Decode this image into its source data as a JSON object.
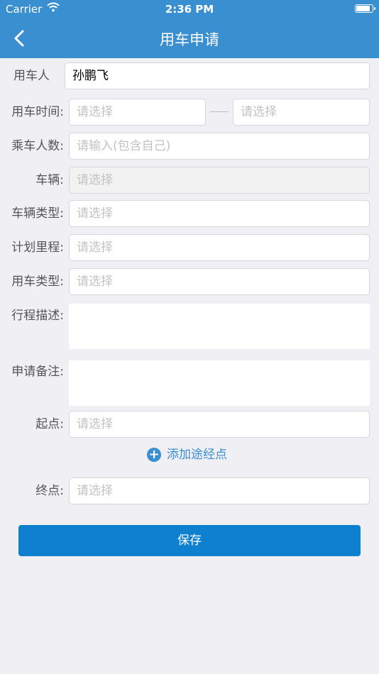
{
  "status_bar": {
    "carrier": "Carrier",
    "time": "2:36 PM",
    "battery_level": 0.9
  },
  "nav": {
    "title": "用车申请",
    "back_icon": "chevron-left-icon"
  },
  "form": {
    "user": {
      "label": "用车人",
      "value": "孙鹏飞"
    },
    "time": {
      "label": "用车时间:",
      "start_placeholder": "请选择",
      "end_placeholder": "请选择"
    },
    "passengers": {
      "label": "乘车人数:",
      "placeholder": "请输入(包含自己)"
    },
    "vehicle": {
      "label": "车辆:",
      "placeholder": "请选择"
    },
    "vehicle_type": {
      "label": "车辆类型:",
      "placeholder": "请选择"
    },
    "planned_mileage": {
      "label": "计划里程:",
      "placeholder": "请选择"
    },
    "usage_type": {
      "label": "用车类型:",
      "placeholder": "请选择"
    },
    "trip_description": {
      "label": "行程描述:"
    },
    "remarks": {
      "label": "申请备注:"
    },
    "start_point": {
      "label": "起点:",
      "placeholder": "请选择"
    },
    "add_waypoint": "添加途经点",
    "end_point": {
      "label": "终点:",
      "placeholder": "请选择"
    }
  },
  "save_label": "保存",
  "colors": {
    "primary": "#3a8fd0",
    "button": "#0f7fcf",
    "background": "#efeff4"
  }
}
